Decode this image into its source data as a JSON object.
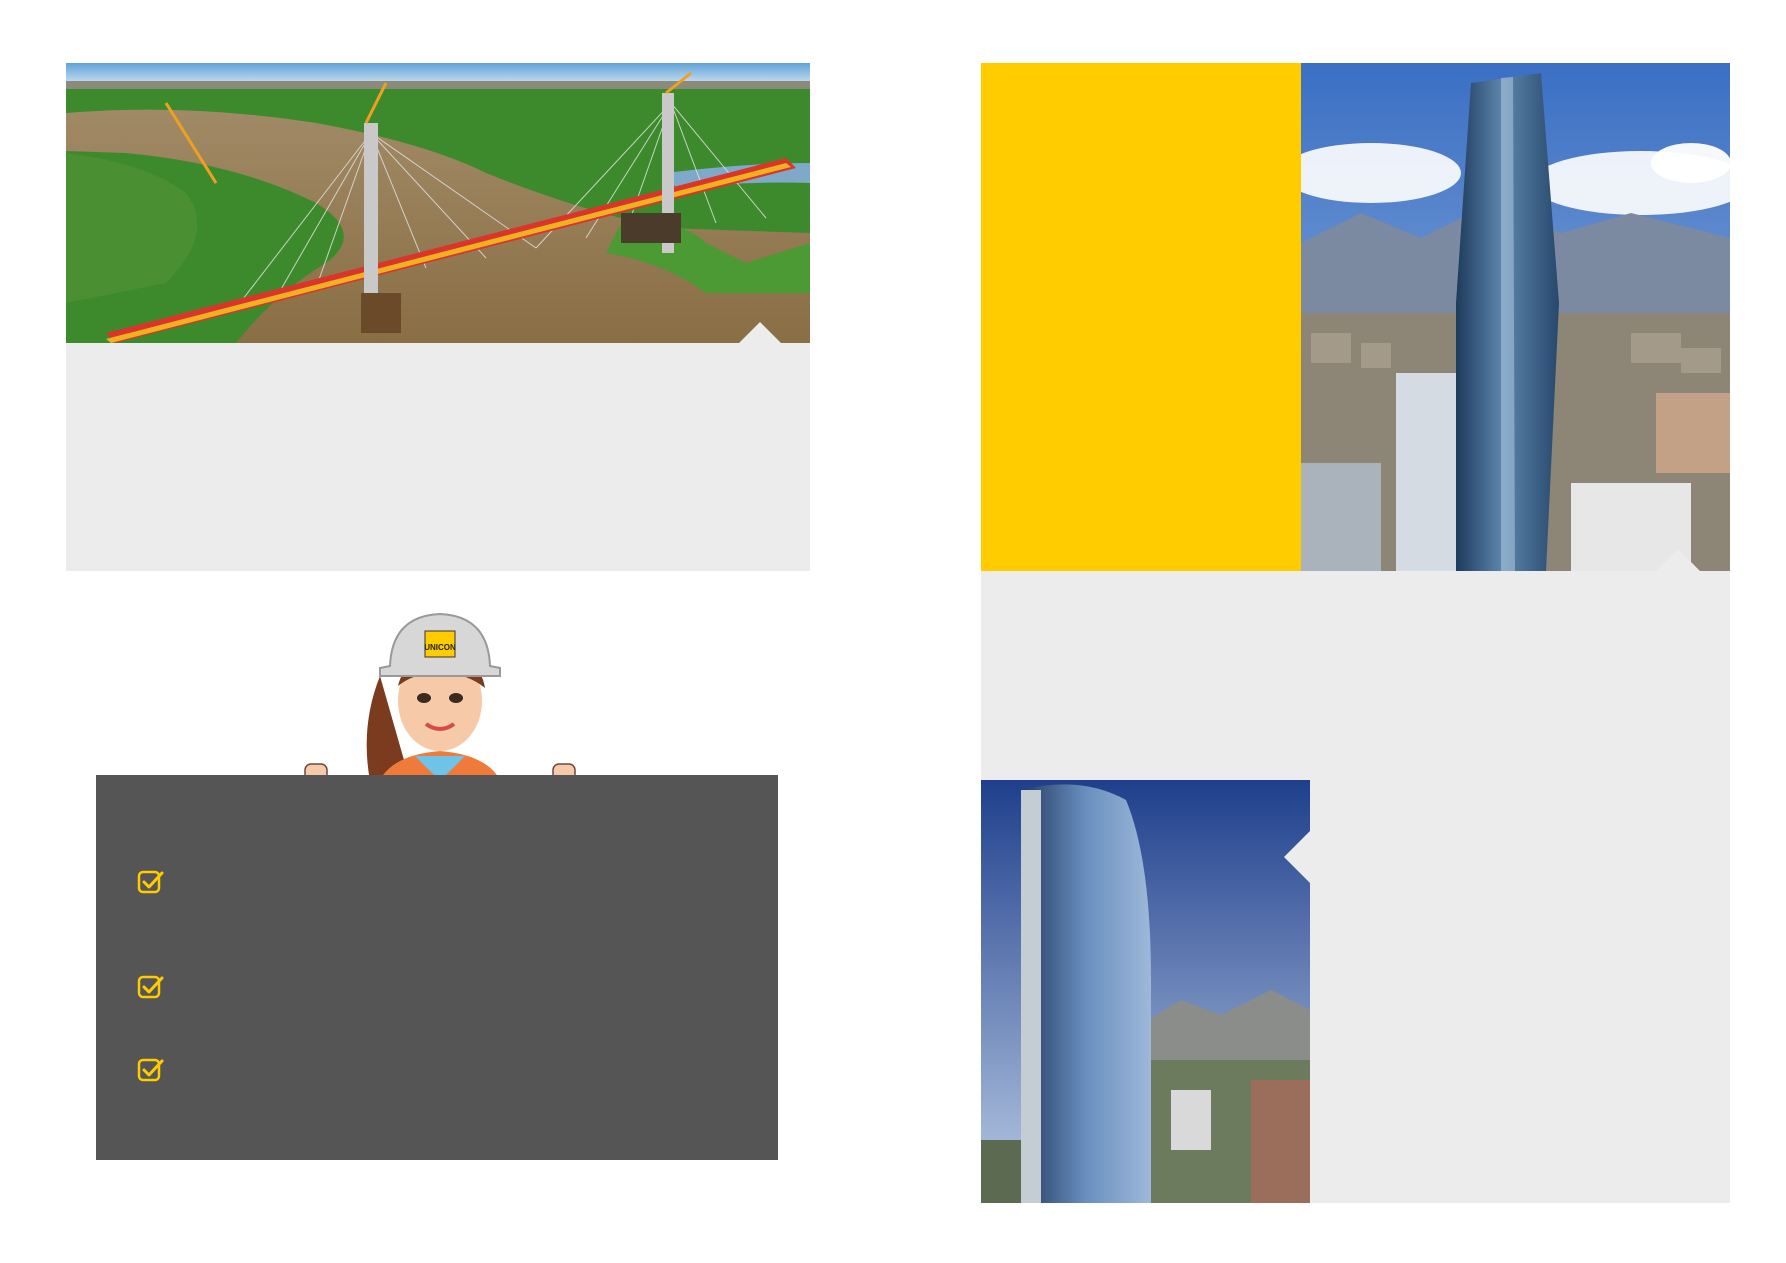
{
  "page": {
    "colors": {
      "background": "#ffffff",
      "card_gray": "#ececec",
      "accent_yellow": "#ffcc00",
      "board_dark": "#555555"
    }
  },
  "bridge_section": {
    "image": "cable-stayed-bridge-construction-photo",
    "caption": ""
  },
  "tower_section": {
    "image": "glass-skyscraper-city-photo",
    "caption": ""
  },
  "tower2_section": {
    "image": "curved-glass-tower-photo",
    "caption": ""
  },
  "mascot": {
    "image": "engineer-woman-hardhat-illustration",
    "helmet_logo_text": "UNICON"
  },
  "board": {
    "items": [
      {
        "icon": "checkbox-checked-icon",
        "text": ""
      },
      {
        "icon": "checkbox-checked-icon",
        "text": ""
      },
      {
        "icon": "checkbox-checked-icon",
        "text": ""
      }
    ]
  }
}
